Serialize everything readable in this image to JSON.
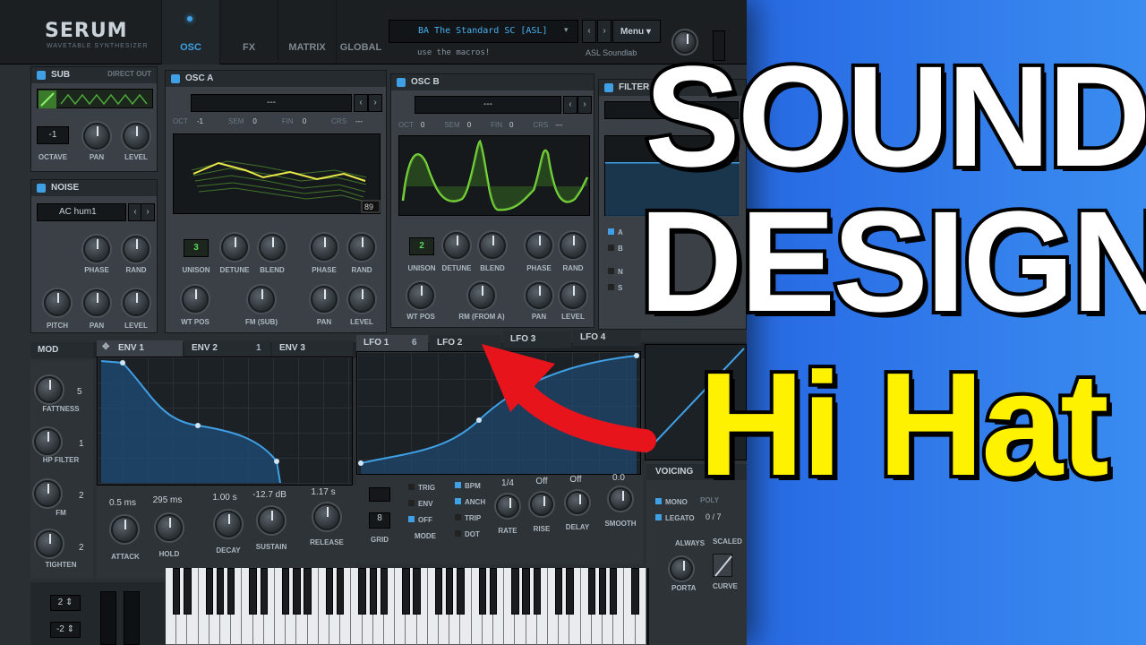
{
  "app": {
    "name": "SERUM",
    "subtitle": "WAVETABLE SYNTHESIZER"
  },
  "nav_tabs": [
    "OSC",
    "FX",
    "MATRIX",
    "GLOBAL"
  ],
  "preset": {
    "name": "BA The Standard SC [ASL]",
    "comment": "use the macros!",
    "author": "ASL Soundlab",
    "menu_label": "Menu"
  },
  "sub": {
    "title": "SUB",
    "direct_out": "DIRECT OUT",
    "octave_value": "-1",
    "labels": [
      "OCTAVE",
      "PAN",
      "LEVEL"
    ]
  },
  "noise": {
    "title": "NOISE",
    "sample": "AC hum1",
    "labels": [
      "PHASE",
      "RAND",
      "PITCH",
      "PAN",
      "LEVEL"
    ]
  },
  "osc_a": {
    "title": "OSC A",
    "wavetable": "---",
    "params": [
      "OCT",
      "-1",
      "SEM",
      "0",
      "FIN",
      "0",
      "CRS",
      "---"
    ],
    "frame": "89",
    "unison": "3",
    "labels": [
      "UNISON",
      "DETUNE",
      "BLEND",
      "PHASE",
      "RAND",
      "WT POS",
      "FM (SUB)",
      "PAN",
      "LEVEL"
    ]
  },
  "osc_b": {
    "title": "OSC B",
    "wavetable": "---",
    "params": [
      "OCT",
      "0",
      "SEM",
      "0",
      "FIN",
      "0",
      "CRS",
      "---"
    ],
    "unison": "2",
    "labels": [
      "UNISON",
      "DETUNE",
      "BLEND",
      "PHASE",
      "RAND",
      "WT POS",
      "RM (FROM A)",
      "PAN",
      "LEVEL"
    ]
  },
  "filter": {
    "title": "FILTER",
    "routes": [
      "A",
      "B",
      "N",
      "S"
    ]
  },
  "mod": {
    "title": "MOD",
    "tabs": [
      "ENV 1",
      "ENV 2",
      "1",
      "ENV 3",
      "LFO 1",
      "6",
      "LFO 2",
      "LFO 3",
      "LFO 4"
    ]
  },
  "macros": [
    {
      "label": "FATTNESS",
      "num": "5"
    },
    {
      "label": "HP FILTER",
      "num": "1"
    },
    {
      "label": "FM",
      "num": "2"
    },
    {
      "label": "TIGHTEN",
      "num": "2"
    }
  ],
  "envelope": {
    "values": [
      "0.5 ms",
      "295 ms",
      "1.00 s",
      "-12.7 dB",
      "1.17 s"
    ],
    "labels": [
      "ATTACK",
      "HOLD",
      "DECAY",
      "SUSTAIN",
      "RELEASE"
    ]
  },
  "lfo": {
    "modes": [
      "TRIG",
      "ENV",
      "OFF"
    ],
    "mode_label": "MODE",
    "grid_label": "GRID",
    "grid_value": "8",
    "options": [
      "BPM",
      "ANCH",
      "TRIP",
      "DOT"
    ],
    "rate_value": "1/4",
    "rise_value": "Off",
    "delay_value": "Off",
    "smooth_value": "0.0",
    "labels": [
      "RATE",
      "RISE",
      "DELAY",
      "SMOOTH"
    ]
  },
  "voicing": {
    "title": "VOICING",
    "mono": "MONO",
    "poly": "POLY",
    "legato": "LEGATO",
    "voices": "0 / 7",
    "always": "ALWAYS",
    "scaled": "SCALED",
    "porta": "PORTA",
    "curve": "CURVE"
  },
  "pitch": {
    "up": "2",
    "down": "-2"
  },
  "headline": {
    "line1": "SOUND",
    "line2": "DESIGN",
    "line3": "Hi Hat"
  },
  "colors": {
    "accent": "#3fa0e6",
    "wave_green": "#6fd23a",
    "headline_yellow": "#fff200",
    "arrow_red": "#e8141c"
  }
}
